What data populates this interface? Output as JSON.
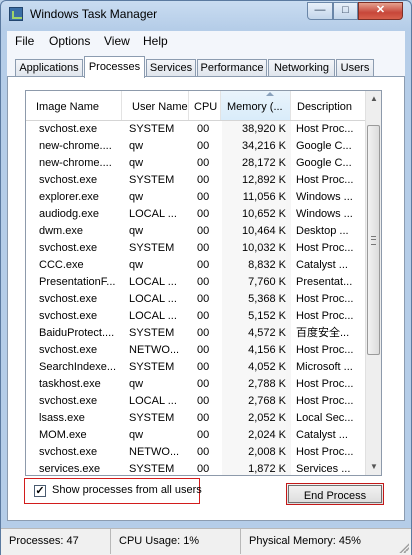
{
  "window": {
    "title": "Windows Task Manager",
    "min_glyph": "—",
    "max_glyph": "□",
    "close_glyph": "✕"
  },
  "menu": [
    "File",
    "Options",
    "View",
    "Help"
  ],
  "tabs": [
    "Applications",
    "Processes",
    "Services",
    "Performance",
    "Networking",
    "Users"
  ],
  "active_tab": "Processes",
  "columns": [
    "Image Name",
    "User Name",
    "CPU",
    "Memory (...",
    "Description"
  ],
  "processes": [
    {
      "name": "svchost.exe",
      "user": "SYSTEM",
      "cpu": "00",
      "mem": "38,920 K",
      "desc": "Host Proc..."
    },
    {
      "name": "new-chrome....",
      "user": "qw",
      "cpu": "00",
      "mem": "34,216 K",
      "desc": "Google C..."
    },
    {
      "name": "new-chrome....",
      "user": "qw",
      "cpu": "00",
      "mem": "28,172 K",
      "desc": "Google C..."
    },
    {
      "name": "svchost.exe",
      "user": "SYSTEM",
      "cpu": "00",
      "mem": "12,892 K",
      "desc": "Host Proc..."
    },
    {
      "name": "explorer.exe",
      "user": "qw",
      "cpu": "00",
      "mem": "11,056 K",
      "desc": "Windows ..."
    },
    {
      "name": "audiodg.exe",
      "user": "LOCAL ...",
      "cpu": "00",
      "mem": "10,652 K",
      "desc": "Windows ..."
    },
    {
      "name": "dwm.exe",
      "user": "qw",
      "cpu": "00",
      "mem": "10,464 K",
      "desc": "Desktop ..."
    },
    {
      "name": "svchost.exe",
      "user": "SYSTEM",
      "cpu": "00",
      "mem": "10,032 K",
      "desc": "Host Proc..."
    },
    {
      "name": "CCC.exe",
      "user": "qw",
      "cpu": "00",
      "mem": "8,832 K",
      "desc": "Catalyst ..."
    },
    {
      "name": "PresentationF...",
      "user": "LOCAL ...",
      "cpu": "00",
      "mem": "7,760 K",
      "desc": "Presentat..."
    },
    {
      "name": "svchost.exe",
      "user": "LOCAL ...",
      "cpu": "00",
      "mem": "5,368 K",
      "desc": "Host Proc..."
    },
    {
      "name": "svchost.exe",
      "user": "LOCAL ...",
      "cpu": "00",
      "mem": "5,152 K",
      "desc": "Host Proc..."
    },
    {
      "name": "BaiduProtect....",
      "user": "SYSTEM",
      "cpu": "00",
      "mem": "4,572 K",
      "desc": "百度安全..."
    },
    {
      "name": "svchost.exe",
      "user": "NETWO...",
      "cpu": "00",
      "mem": "4,156 K",
      "desc": "Host Proc..."
    },
    {
      "name": "SearchIndexe...",
      "user": "SYSTEM",
      "cpu": "00",
      "mem": "4,052 K",
      "desc": "Microsoft ..."
    },
    {
      "name": "taskhost.exe",
      "user": "qw",
      "cpu": "00",
      "mem": "2,788 K",
      "desc": "Host Proc..."
    },
    {
      "name": "svchost.exe",
      "user": "LOCAL ...",
      "cpu": "00",
      "mem": "2,768 K",
      "desc": "Host Proc..."
    },
    {
      "name": "lsass.exe",
      "user": "SYSTEM",
      "cpu": "00",
      "mem": "2,052 K",
      "desc": "Local Sec..."
    },
    {
      "name": "MOM.exe",
      "user": "qw",
      "cpu": "00",
      "mem": "2,024 K",
      "desc": "Catalyst ..."
    },
    {
      "name": "svchost.exe",
      "user": "NETWO...",
      "cpu": "00",
      "mem": "2,008 K",
      "desc": "Host Proc..."
    },
    {
      "name": "services.exe",
      "user": "SYSTEM",
      "cpu": "00",
      "mem": "1,872 K",
      "desc": "Services ..."
    }
  ],
  "show_all": {
    "label": "Show processes from all users",
    "checked": true,
    "check_glyph": "✓"
  },
  "end_process_label": "End Process",
  "status": {
    "processes": "Processes: 47",
    "cpu": "CPU Usage: 1%",
    "memory": "Physical Memory: 45%"
  },
  "colors": {
    "highlight_border": "#d21c1c",
    "window_frame": "#b5cde8"
  }
}
